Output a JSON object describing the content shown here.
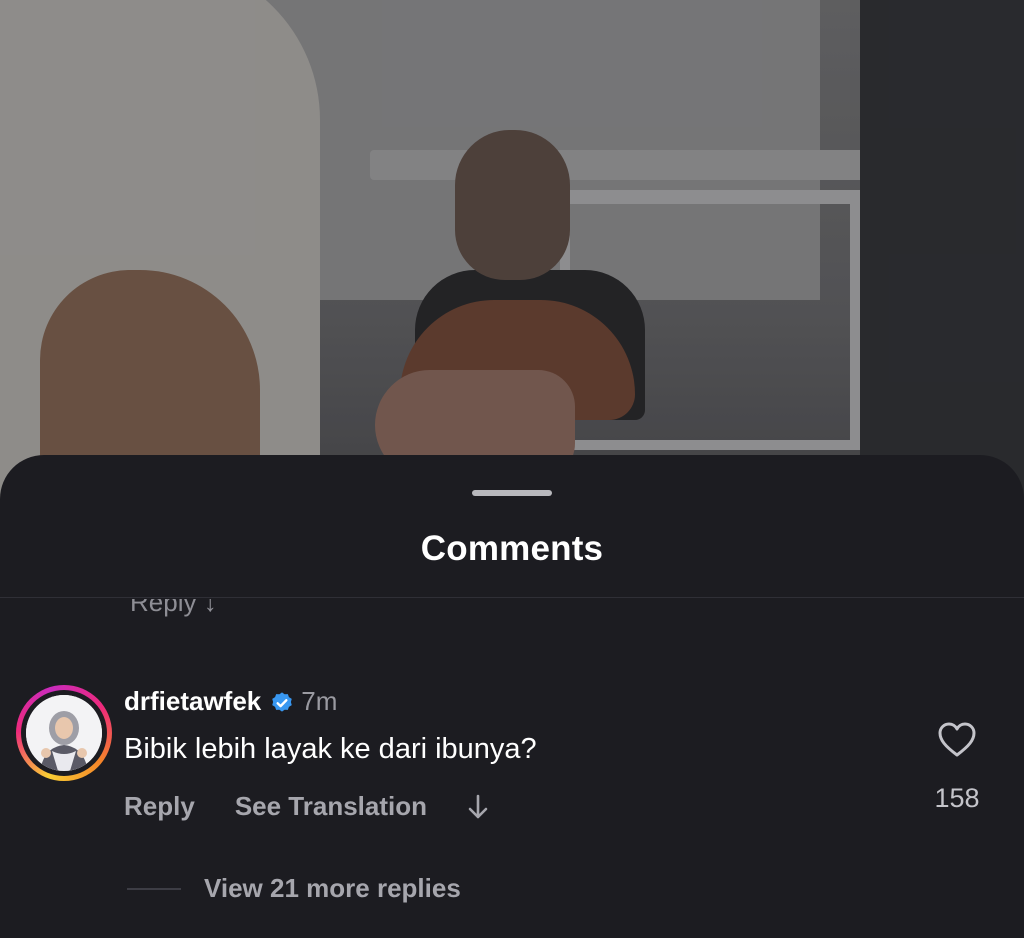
{
  "sheet": {
    "title": "Comments",
    "peek_text": "Reply  ↓"
  },
  "comment": {
    "username": "drfietawfek",
    "verified": true,
    "timestamp": "7m",
    "text": "Bibik lebih layak ke dari ibunya?",
    "reply_label": "Reply",
    "translate_label": "See Translation",
    "likes": "158",
    "view_replies_label": "View 21 more replies"
  },
  "icons": {
    "verified": "verified-badge-icon",
    "like": "heart-outline-icon",
    "expand": "arrow-down-icon"
  },
  "colors": {
    "sheet_bg": "#1c1c21",
    "verified_blue": "#3897f0",
    "muted_text": "#a6a6ad"
  }
}
